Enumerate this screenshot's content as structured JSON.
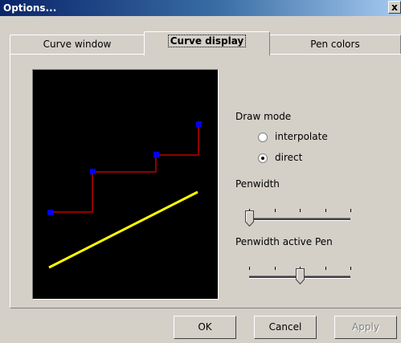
{
  "window": {
    "title": "Options...",
    "close_glyph": "x"
  },
  "tabs": [
    {
      "label": "Curve window",
      "active": false
    },
    {
      "label": "Curve display",
      "active": true
    },
    {
      "label": "Pen colors",
      "active": false
    }
  ],
  "draw_mode": {
    "label": "Draw mode",
    "options": [
      {
        "label": "interpolate",
        "selected": false
      },
      {
        "label": "direct",
        "selected": true
      }
    ]
  },
  "penwidth": {
    "label": "Penwidth",
    "value": 0,
    "max": 4
  },
  "penwidth_active": {
    "label": "Penwidth active Pen",
    "value": 2,
    "max": 4
  },
  "buttons": {
    "ok": "OK",
    "cancel": "Cancel",
    "apply": "Apply"
  },
  "preview_colors": {
    "background": "#000000",
    "step_line": "#c00000",
    "point": "#0000ff",
    "straight_line": "#ffff00"
  }
}
